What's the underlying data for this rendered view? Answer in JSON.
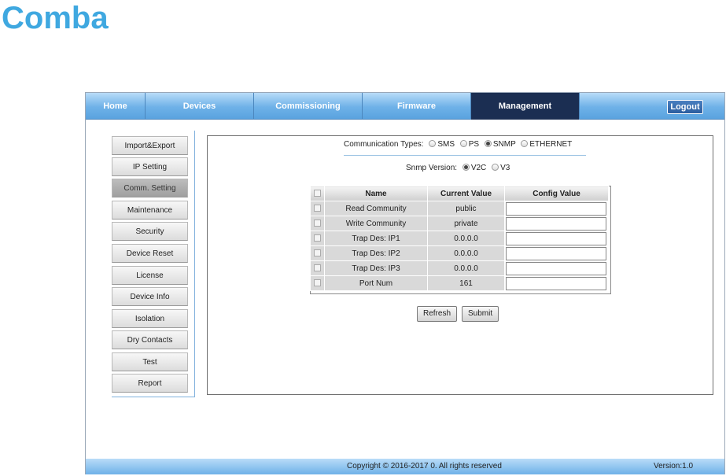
{
  "brand": {
    "logo_text": "Comba",
    "color": "#3fa8e0"
  },
  "nav": {
    "items": [
      {
        "label": "Home",
        "active": false
      },
      {
        "label": "Devices",
        "active": false
      },
      {
        "label": "Commissioning",
        "active": false
      },
      {
        "label": "Firmware",
        "active": false
      },
      {
        "label": "Management",
        "active": true
      }
    ],
    "logout_label": "Logout"
  },
  "sidebar": {
    "items": [
      {
        "label": "Import&Export",
        "active": false
      },
      {
        "label": "IP Setting",
        "active": false
      },
      {
        "label": "Comm. Setting",
        "active": true
      },
      {
        "label": "Maintenance",
        "active": false
      },
      {
        "label": "Security",
        "active": false
      },
      {
        "label": "Device Reset",
        "active": false
      },
      {
        "label": "License",
        "active": false
      },
      {
        "label": "Device Info",
        "active": false
      },
      {
        "label": "Isolation",
        "active": false
      },
      {
        "label": "Dry Contacts",
        "active": false
      },
      {
        "label": "Test",
        "active": false
      },
      {
        "label": "Report",
        "active": false
      }
    ]
  },
  "comm": {
    "types_label": "Communication Types:",
    "types": [
      {
        "label": "SMS",
        "selected": false
      },
      {
        "label": "PS",
        "selected": false
      },
      {
        "label": "SNMP",
        "selected": true
      },
      {
        "label": "ETHERNET",
        "selected": false
      }
    ],
    "snmp_version_label": "Snmp Version:",
    "versions": [
      {
        "label": "V2C",
        "selected": true
      },
      {
        "label": "V3",
        "selected": false
      }
    ]
  },
  "table": {
    "headers": {
      "name": "Name",
      "current": "Current Value",
      "config": "Config Value"
    },
    "rows": [
      {
        "name": "Read Community",
        "current": "public",
        "config": ""
      },
      {
        "name": "Write Community",
        "current": "private",
        "config": ""
      },
      {
        "name": "Trap Des: IP1",
        "current": "0.0.0.0",
        "config": ""
      },
      {
        "name": "Trap Des: IP2",
        "current": "0.0.0.0",
        "config": ""
      },
      {
        "name": "Trap Des: IP3",
        "current": "0.0.0.0",
        "config": ""
      },
      {
        "name": "Port Num",
        "current": "161",
        "config": ""
      }
    ]
  },
  "actions": {
    "refresh_label": "Refresh",
    "submit_label": "Submit"
  },
  "footer": {
    "copyright": "Copyright © 2016-2017 0. All rights reserved",
    "version": "Version:1.0"
  }
}
